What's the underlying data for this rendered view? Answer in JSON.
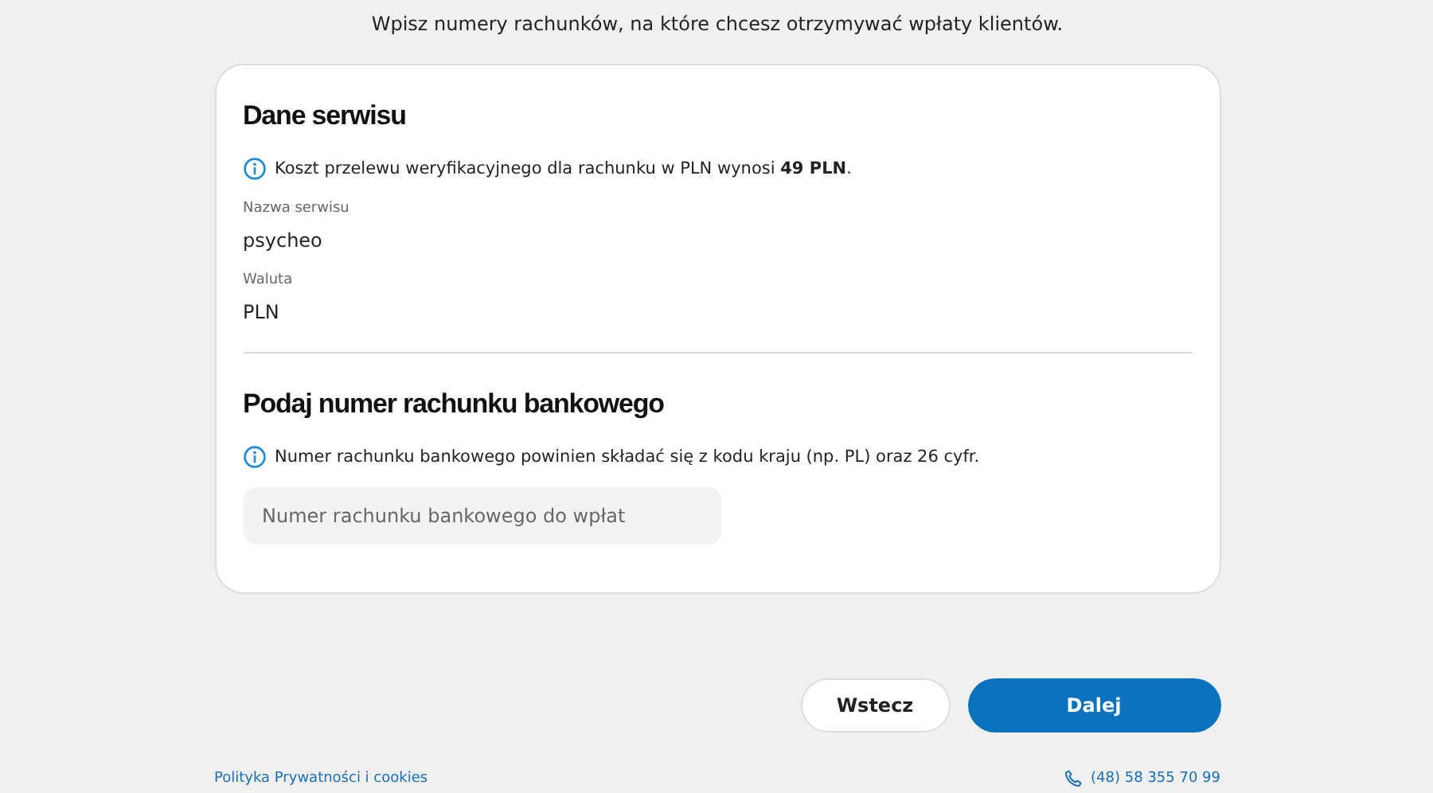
{
  "intro": "Wpisz numery rachunków, na które chcesz otrzymywać wpłaty klientów.",
  "service": {
    "title": "Dane serwisu",
    "info": "Koszt przelewu weryfikacyjnego dla rachunku w PLN wynosi **49 PLN**.",
    "fields": [
      {
        "label": "Nazwa serwisu",
        "value": "psycheo"
      },
      {
        "label": "Waluta",
        "value": "PLN"
      }
    ]
  },
  "account": {
    "title": "Podaj numer rachunku bankowego",
    "info": "Numer rachunku bankowego powinien składać się z kodu kraju (np. PL) oraz 26 cyfr.",
    "placeholder": "Numer rachunku bankowego do wpłat"
  },
  "buttons": [
    {
      "label": "Wstecz",
      "kind": "secondary"
    },
    {
      "label": "Dalej",
      "kind": "primary"
    }
  ],
  "footer": {
    "link": "Polityka Prywatności i cookies",
    "phone": "(48) 58 355 70 99"
  }
}
